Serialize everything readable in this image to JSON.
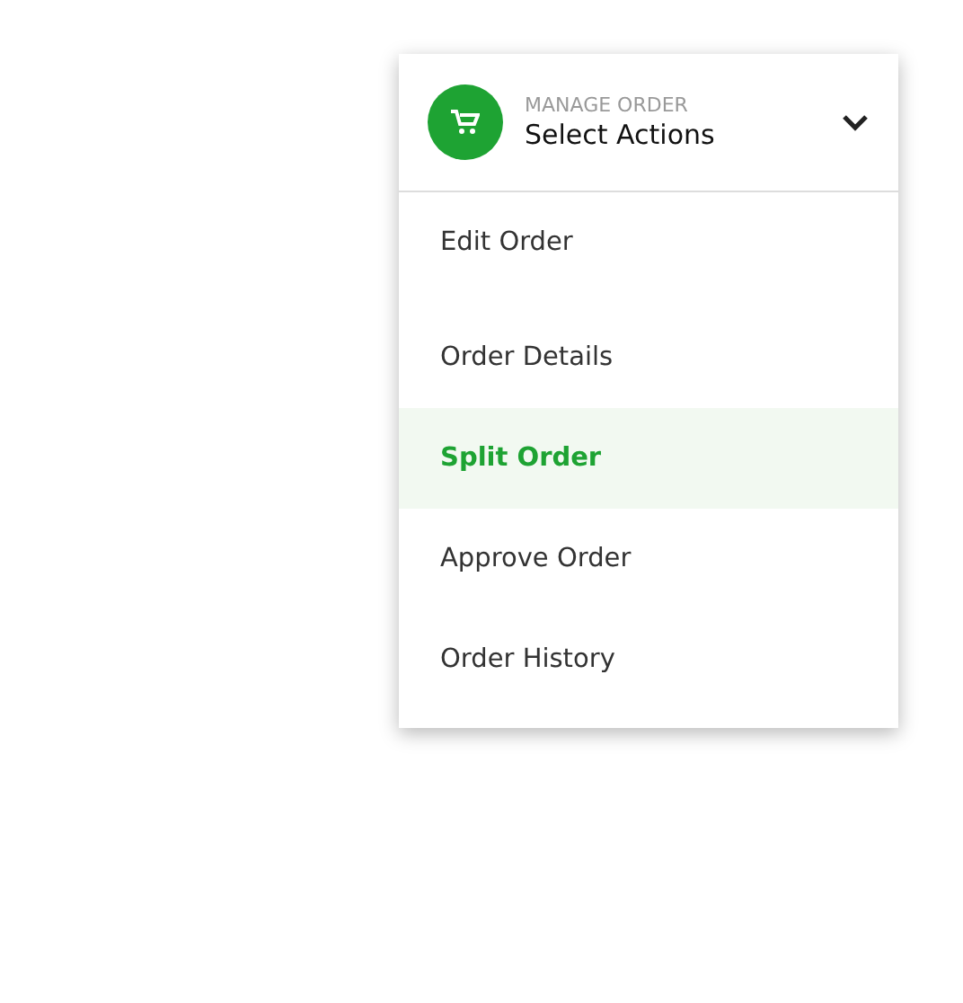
{
  "menu": {
    "subtitle": "MANAGE ORDER",
    "title": "Select Actions",
    "expanded": true,
    "items": [
      {
        "label": "Edit Order",
        "selected": false
      },
      {
        "label": "Order Details",
        "selected": false
      },
      {
        "label": "Split Order",
        "selected": true
      },
      {
        "label": "Approve Order",
        "selected": false
      },
      {
        "label": "Order History",
        "selected": false
      }
    ]
  }
}
